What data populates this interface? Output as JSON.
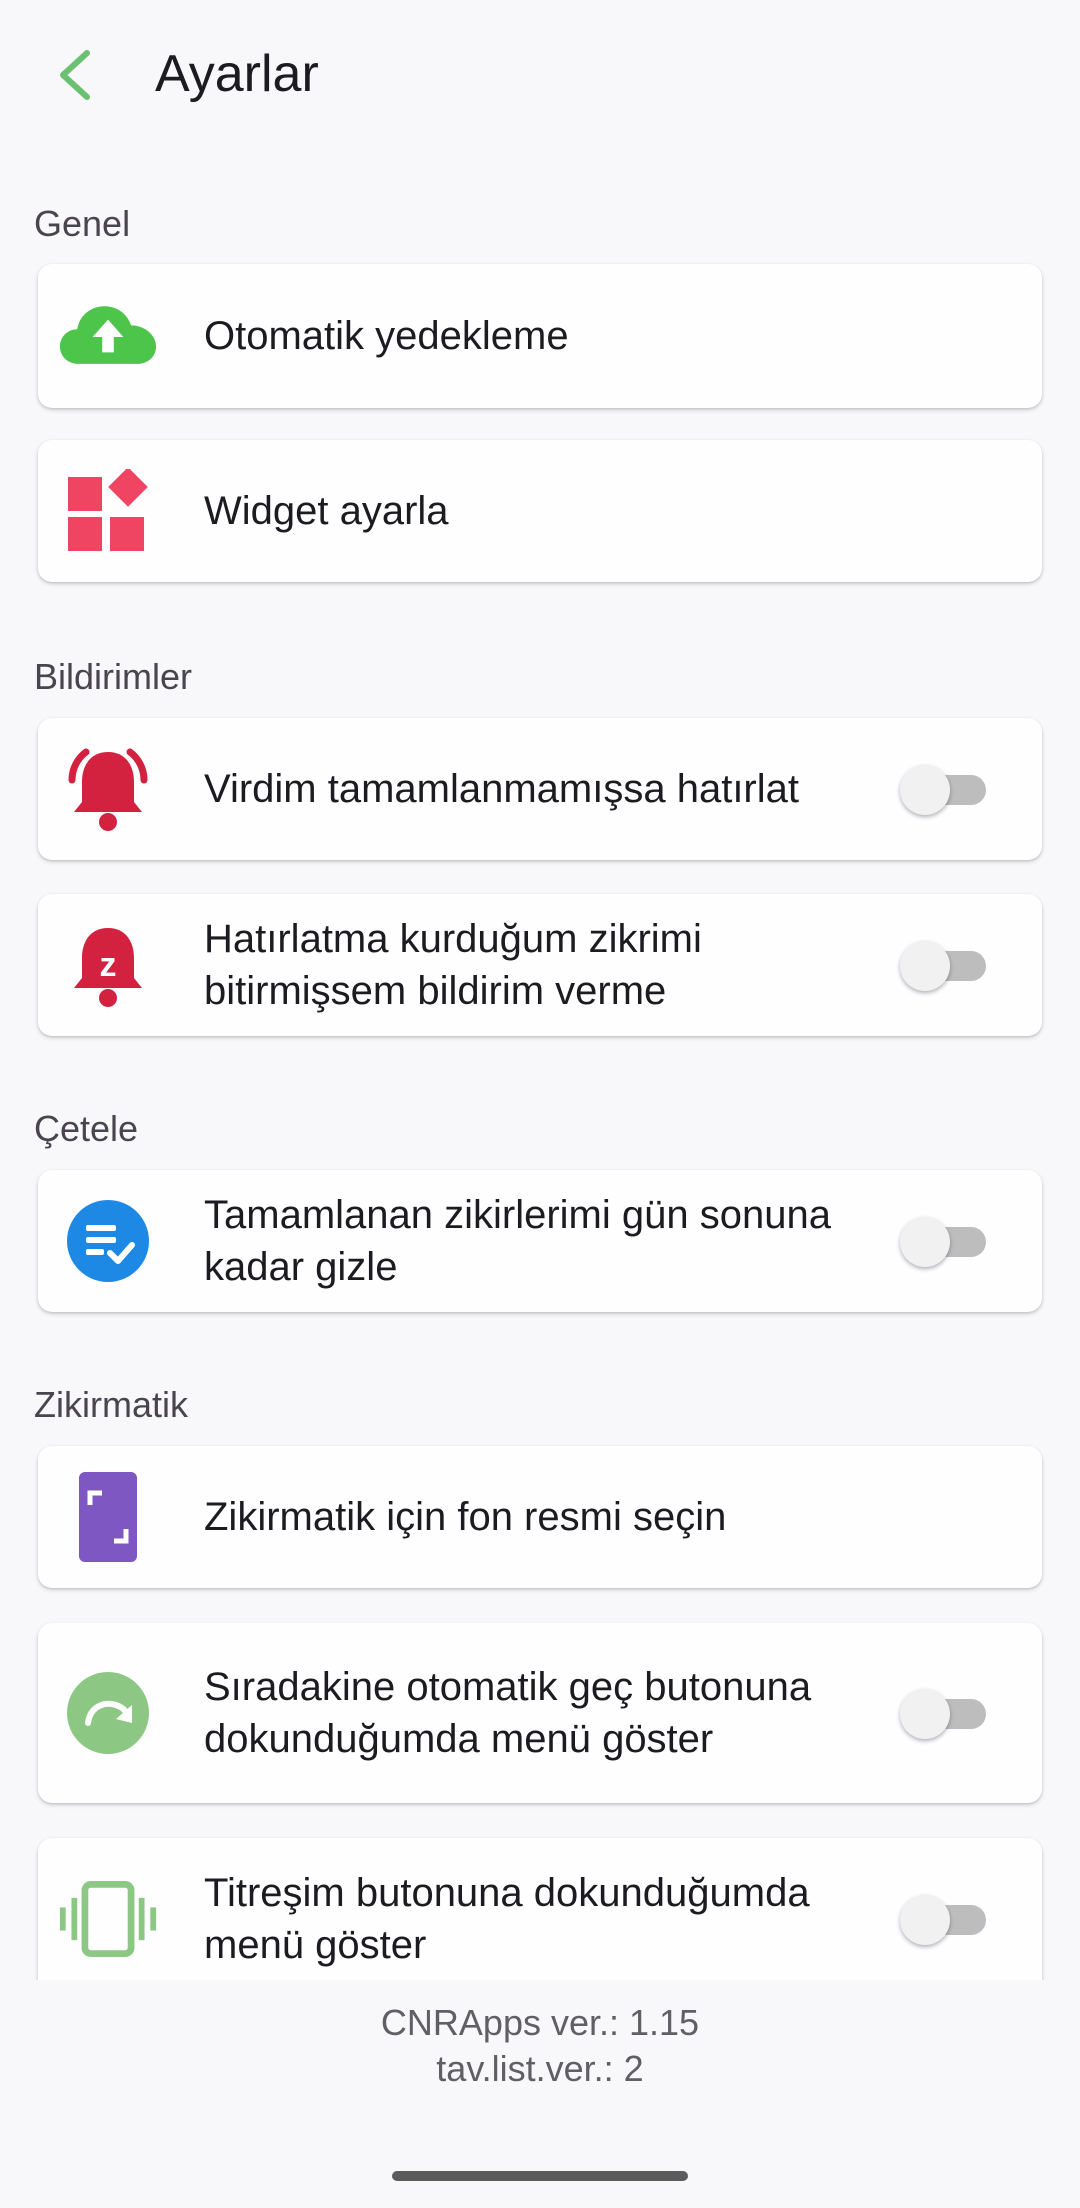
{
  "header": {
    "title": "Ayarlar",
    "back_icon": "chevron-left-icon"
  },
  "colors": {
    "accent_green": "#6cc071",
    "cloud_green": "#4cc54a",
    "widget_red": "#ef4462",
    "bell_red": "#d2223f",
    "checklist_blue": "#1e88e5",
    "wallpaper_purple": "#7e57c2",
    "next_green": "#8cc883",
    "vibrate_green": "#8cc883"
  },
  "sections": {
    "general": {
      "title": "Genel",
      "items": [
        {
          "label": "Otomatik yedekleme",
          "icon": "cloud-upload-icon"
        },
        {
          "label": "Widget ayarla",
          "icon": "widgets-icon"
        }
      ]
    },
    "notifications": {
      "title": "Bildirimler",
      "items": [
        {
          "label": "Virdim tamamlanmamışsa hatırlat",
          "icon": "bell-ringing-icon",
          "toggle": false
        },
        {
          "label": "Hatırlatma kurduğum zikrimi bitirmişsem bildirim verme",
          "icon": "bell-snooze-icon",
          "toggle": false
        }
      ]
    },
    "tally": {
      "title": "Çetele",
      "items": [
        {
          "label": "Tamamlanan zikirlerimi gün sonuna kadar gizle",
          "icon": "checklist-icon",
          "toggle": false
        }
      ]
    },
    "counter": {
      "title": "Zikirmatik",
      "items": [
        {
          "label": "Zikirmatik için fon resmi seçin",
          "icon": "wallpaper-icon"
        },
        {
          "label": "Sıradakine otomatik geç butonuna dokunduğumda menü göster",
          "icon": "redo-icon",
          "toggle": false
        },
        {
          "label": "Titreşim butonuna dokunduğumda menü göster",
          "icon": "vibrate-icon",
          "toggle": false
        }
      ]
    }
  },
  "footer": {
    "version": "CNRApps ver.: 1.15",
    "list_version": "tav.list.ver.: 2"
  }
}
